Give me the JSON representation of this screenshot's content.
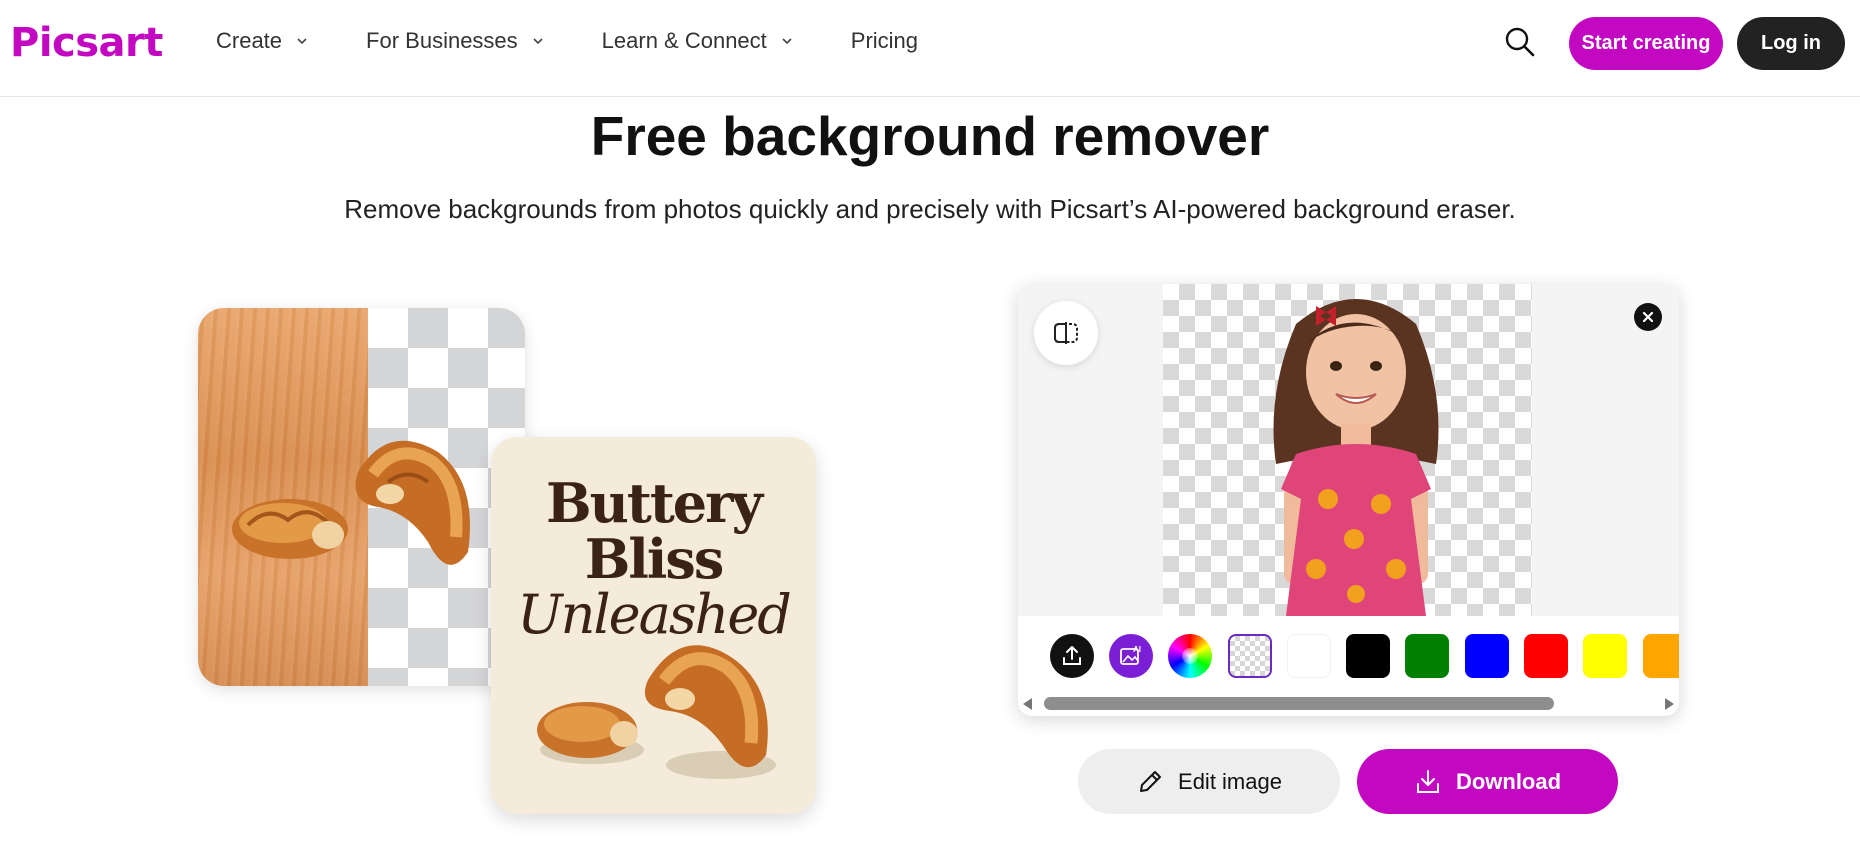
{
  "header": {
    "logo_text": "Picsart",
    "nav": [
      {
        "label": "Create",
        "has_dropdown": true
      },
      {
        "label": "For Businesses",
        "has_dropdown": true
      },
      {
        "label": "Learn & Connect",
        "has_dropdown": true
      },
      {
        "label": "Pricing",
        "has_dropdown": false
      }
    ],
    "start_label": "Start creating",
    "login_label": "Log in"
  },
  "hero": {
    "title": "Free background remover",
    "subtitle": "Remove backgrounds from photos quickly and precisely with Picsart’s AI-powered background eraser."
  },
  "showcase": {
    "poster_line1": "Buttery",
    "poster_line2": "Bliss",
    "poster_line3": "Unleashed"
  },
  "editor": {
    "tools": [
      {
        "name": "upload-icon",
        "color": "#111111"
      },
      {
        "name": "ai-image-icon",
        "color": "#7a1fd6"
      },
      {
        "name": "color-wheel-icon"
      }
    ],
    "swatches": [
      {
        "name": "transparent",
        "selected": true
      },
      {
        "name": "white",
        "color": "#ffffff"
      },
      {
        "name": "black",
        "color": "#000000"
      },
      {
        "name": "green",
        "color": "#008000"
      },
      {
        "name": "blue",
        "color": "#0000ff"
      },
      {
        "name": "red",
        "color": "#ff0000"
      },
      {
        "name": "yellow",
        "color": "#ffff00"
      },
      {
        "name": "orange",
        "color": "#ffa500"
      }
    ]
  },
  "actions": {
    "edit_label": "Edit image",
    "download_label": "Download"
  },
  "colors": {
    "brand": "#c209c1",
    "dark": "#222222"
  }
}
